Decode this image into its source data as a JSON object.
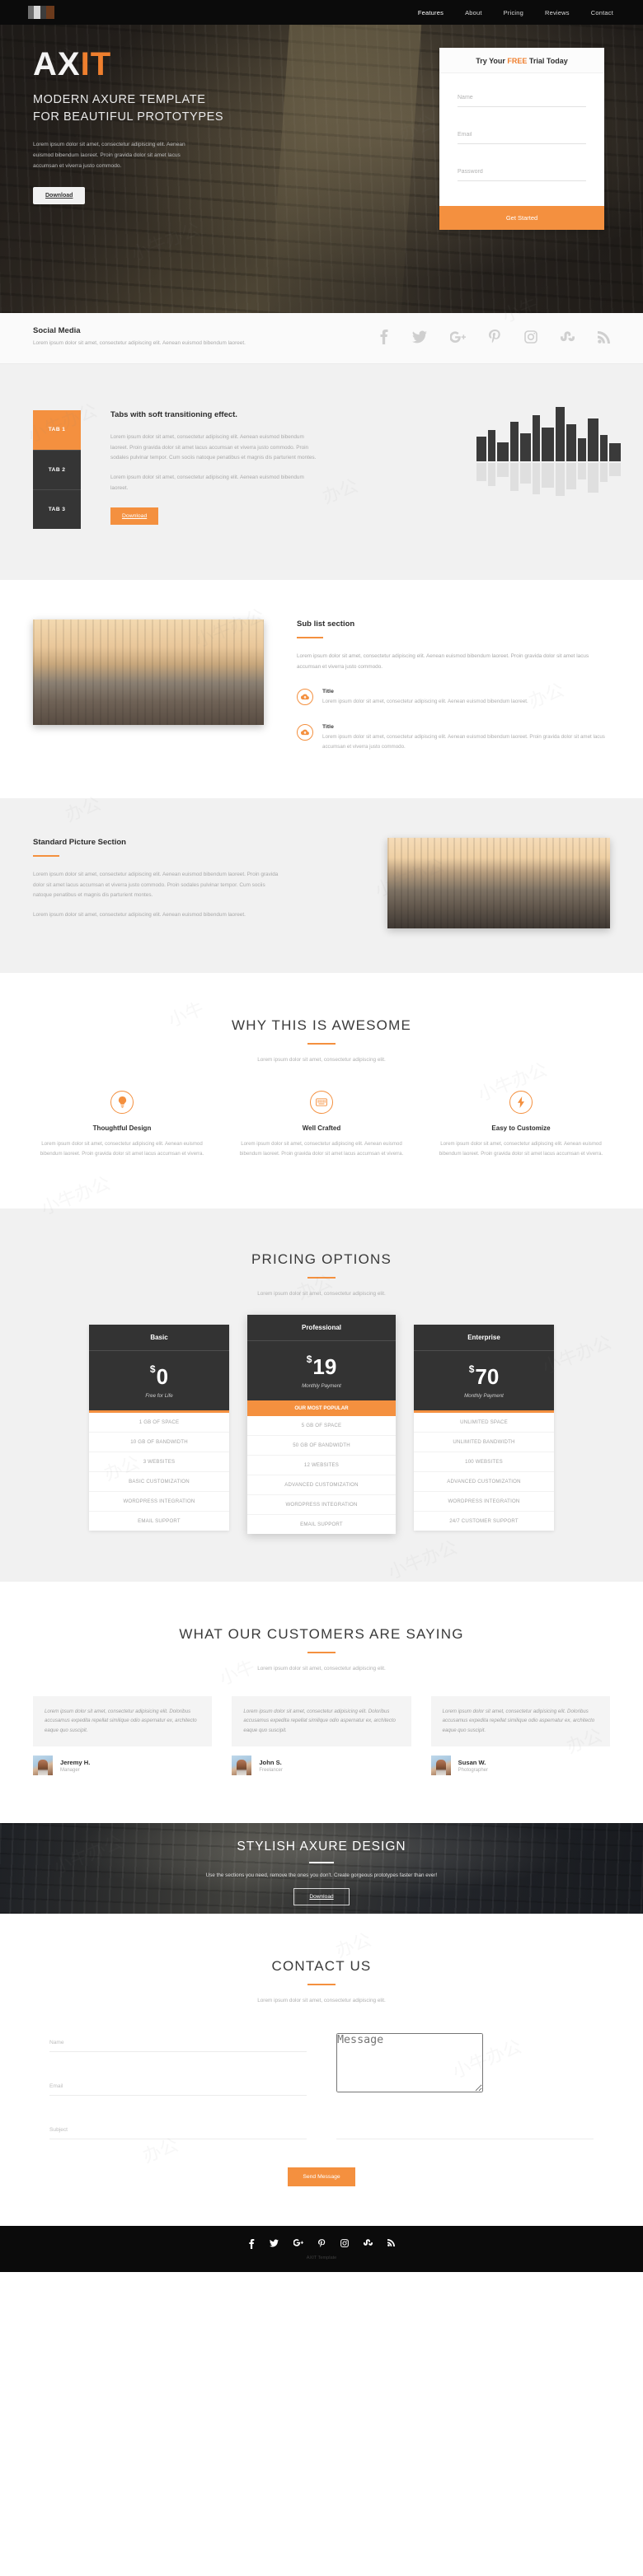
{
  "nav": {
    "logo_name": "axit-logo",
    "items": [
      {
        "label": "Features"
      },
      {
        "label": "About"
      },
      {
        "label": "Pricing"
      },
      {
        "label": "Reviews"
      },
      {
        "label": "Contact"
      }
    ]
  },
  "hero": {
    "brand_prefix": "AX",
    "brand_suffix": "IT",
    "tagline_line1": "MODERN AXURE TEMPLATE",
    "tagline_line2": "FOR BEAUTIFUL PROTOTYPES",
    "paragraph": "Lorem ipsum dolor sit amet, consectetur adipiscing elit. Aenean euismod bibendum laoreet. Proin gravida dolor sit amet lacus accumsan et viverra justo commodo.",
    "download_label": "Download"
  },
  "trial": {
    "title_before": "Try Your ",
    "title_highlight": "FREE",
    "title_after": " Trial Today",
    "name_placeholder": "Name",
    "email_placeholder": "Email",
    "password_placeholder": "Password",
    "name_value": "",
    "email_value": "",
    "password_value": "",
    "button_label": "Get Started"
  },
  "social": {
    "title": "Social Media",
    "paragraph": "Lorem ipsum dolor sit amet, consectetur adipiscing elit. Aenean euismod bibendum laoreet.",
    "icons": [
      "facebook-icon",
      "twitter-icon",
      "google-plus-icon",
      "pinterest-icon",
      "instagram-icon",
      "stumbleupon-icon",
      "rss-icon"
    ]
  },
  "tabs": {
    "items": [
      {
        "label": "TAB 1",
        "active": true
      },
      {
        "label": "TAB 2",
        "active": false
      },
      {
        "label": "TAB 3",
        "active": false
      }
    ],
    "heading": "Tabs with soft transitioning effect.",
    "paragraph1": "Lorem ipsum dolor sit amet, consectetur adipiscing elit. Aenean euismod bibendum laoreet. Proin gravida dolor sit amet lacus accumsan et viverra justo commodo. Proin sodales pulvinar tempor. Cum sociis natoque penatibus et magnis dis parturient montes.",
    "paragraph2": "Lorem ipsum dolor sit amet, consectetur adipiscing elit. Aenean euismod bibendum laoreet.",
    "download_label": "Download"
  },
  "sublist": {
    "heading": "Sub list section",
    "intro": "Lorem ipsum dolor sit amet, consectetur adipiscing elit. Aenean euismod bibendum laoreet. Proin gravida dolor sit amet lacus accumsan et viverra justo commodo.",
    "items": [
      {
        "icon": "cloud-upload-icon",
        "title": "Title",
        "text": "Lorem ipsum dolor sit amet, consectetur adipiscing elit. Aenean euismod bibendum laoreet."
      },
      {
        "icon": "cloud-upload-icon",
        "title": "Title",
        "text": "Lorem ipsum dolor sit amet, consectetur adipiscing elit. Aenean euismod bibendum laoreet. Proin gravida dolor sit amet lacus accumsan et viverra justo commodo."
      }
    ]
  },
  "standard": {
    "heading": "Standard Picture Section",
    "paragraph1": "Lorem ipsum dolor sit amet, consectetur adipiscing elit. Aenean euismod bibendum laoreet. Proin gravida dolor sit amet lacus accumsan et viverra justo commodo. Proin sodales pulvinar tempor. Cum sociis natoque penatibus et magnis dis parturient montes.",
    "paragraph2": "Lorem ipsum dolor sit amet, consectetur adipiscing elit. Aenean euismod bibendum laoreet."
  },
  "features": {
    "heading": "WHY THIS IS AWESOME",
    "subtitle": "Lorem ipsum dolor sit amet, consectetur adipiscing elit.",
    "items": [
      {
        "icon": "lightbulb-icon",
        "title": "Thoughtful Design",
        "text": "Lorem ipsum dolor sit amet, consectetur adipiscing elit. Aenean euismod bibendum laoreet. Proin gravida dolor sit amet lacus accumsan et viverra."
      },
      {
        "icon": "keyboard-icon",
        "title": "Well Crafted",
        "text": "Lorem ipsum dolor sit amet, consectetur adipiscing elit. Aenean euismod bibendum laoreet. Proin gravida dolor sit amet lacus accumsan et viverra."
      },
      {
        "icon": "bolt-icon",
        "title": "Easy to Customize",
        "text": "Lorem ipsum dolor sit amet, consectetur adipiscing elit. Aenean euismod bibendum laoreet. Proin gravida dolor sit amet lacus accumsan et viverra."
      }
    ]
  },
  "pricing": {
    "heading": "PRICING OPTIONS",
    "subtitle": "Lorem ipsum dolor sit amet, consectetur adipiscing elit.",
    "plans": [
      {
        "name": "Basic",
        "currency": "$",
        "amount": "0",
        "period": "Free for Life",
        "popular": false,
        "ribbon": "",
        "features": [
          "1 GB OF SPACE",
          "10 GB OF BANDWIDTH",
          "3 WEBSITES",
          "BASIC CUSTOMIZATION",
          "WORDPRESS INTEGRATION",
          "EMAIL SUPPORT"
        ]
      },
      {
        "name": "Professional",
        "currency": "$",
        "amount": "19",
        "period": "Monthly Payment",
        "popular": true,
        "ribbon": "OUR MOST POPULAR",
        "features": [
          "5 GB OF SPACE",
          "50 GB OF BANDWIDTH",
          "12 WEBSITES",
          "ADVANCED CUSTOMIZATION",
          "WORDPRESS INTEGRATION",
          "EMAIL SUPPORT"
        ]
      },
      {
        "name": "Enterprise",
        "currency": "$",
        "amount": "70",
        "period": "Monthly Payment",
        "popular": false,
        "ribbon": "",
        "features": [
          "UNLIMITED SPACE",
          "UNLIMITED BANDWIDTH",
          "100 WEBSITES",
          "ADVANCED CUSTOMIZATION",
          "WORDPRESS INTEGRATION",
          "24/7 CUSTOMER SUPPORT"
        ]
      }
    ]
  },
  "testimonials": {
    "heading": "WHAT OUR CUSTOMERS ARE SAYING",
    "subtitle": "Lorem ipsum dolor sit amet, consectetur adipiscing elit.",
    "items": [
      {
        "quote": "Lorem ipsum dolor sit amet, consectetur adipisicing elit. Doloribus accusamus expedita repellat similique odio aspernatur ex, architecto eaque quo suscipit.",
        "name": "Jeremy H.",
        "role": "Manager"
      },
      {
        "quote": "Lorem ipsum dolor sit amet, consectetur adipisicing elit. Doloribus accusamus expedita repellat similique odio aspernatur ex, architecto eaque quo suscipit.",
        "name": "John S.",
        "role": "Freelancer"
      },
      {
        "quote": "Lorem ipsum dolor sit amet, consectetur adipisicing elit. Doloribus accusamus expedita repellat similique odio aspernatur ex, architecto eaque quo suscipit.",
        "name": "Susan W.",
        "role": "Photographer"
      }
    ]
  },
  "cta": {
    "heading": "STYLISH AXURE DESIGN",
    "paragraph": "Use the sections you need, remove the ones you don't.  Create gorgeous prototypes faster than ever!",
    "button_label": "Download"
  },
  "contact": {
    "heading": "CONTACT US",
    "subtitle": "Lorem ipsum dolor sit amet, consectetur adipiscing elit.",
    "name_placeholder": "Name",
    "email_placeholder": "Email",
    "subject_placeholder": "Subject",
    "message_placeholder": "Message",
    "name_value": "",
    "email_value": "",
    "subject_value": "",
    "message_value": "",
    "send_label": "Send Message"
  },
  "footer": {
    "icons": [
      "facebook-icon",
      "twitter-icon",
      "google-plus-icon",
      "pinterest-icon",
      "instagram-icon",
      "stumbleupon-icon",
      "rss-icon"
    ],
    "copyright": "AXIT Template"
  },
  "colors": {
    "accent": "#f4903f",
    "dark": "#333333",
    "black": "#0b0b0b",
    "light_bg": "#f1f1f1",
    "muted_text": "#a9a9a9"
  }
}
